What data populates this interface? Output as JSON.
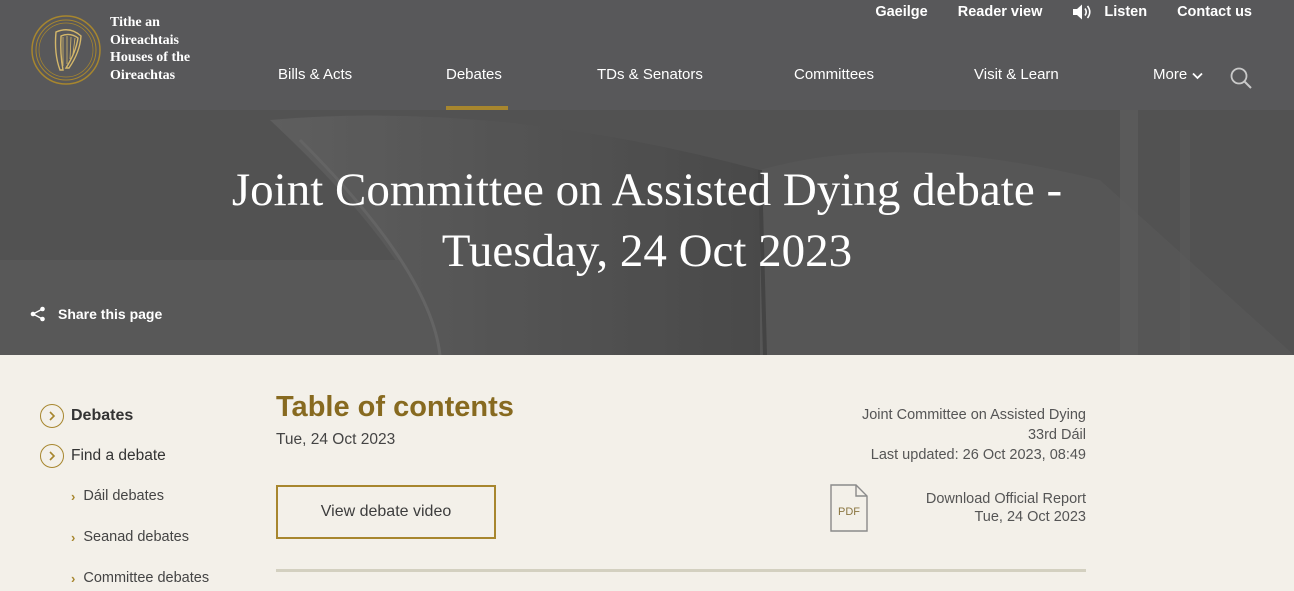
{
  "logo": {
    "lines": [
      "Tithe an",
      "Oireachtais",
      "Houses of the",
      "Oireachtas"
    ],
    "icon": "harp-icon"
  },
  "util_nav": {
    "gaeilge": "Gaeilge",
    "reader_view": "Reader view",
    "listen": "Listen",
    "contact": "Contact us"
  },
  "main_nav": {
    "items": [
      "Bills & Acts",
      "Debates",
      "TDs & Senators",
      "Committees",
      "Visit & Learn",
      "More"
    ],
    "active": "Debates"
  },
  "hero": {
    "title_line1": "Joint Committee on Assisted Dying debate -",
    "title_line2": "Tuesday, 24 Oct 2023",
    "share": "Share this page"
  },
  "sidebar": {
    "items": [
      "Debates",
      "Find a debate"
    ],
    "subitems": [
      "Dáil debates",
      "Seanad debates",
      "Committee debates"
    ]
  },
  "main": {
    "toc_title": "Table of contents",
    "toc_date": "Tue, 24 Oct 2023",
    "video_button": "View debate video",
    "meta": {
      "committee": "Joint Committee on Assisted Dying",
      "dail": "33rd Dáil",
      "last_updated": "Last updated: 26 Oct 2023, 08:49"
    },
    "download": {
      "icon_label": "PDF",
      "label": "Download Official Report",
      "date": "Tue, 24 Oct 2023"
    }
  },
  "colors": {
    "header_bg": "#58585a",
    "accent_gold": "#a7862e",
    "title_gold": "#876a20",
    "page_bg": "#f3f0e9"
  }
}
